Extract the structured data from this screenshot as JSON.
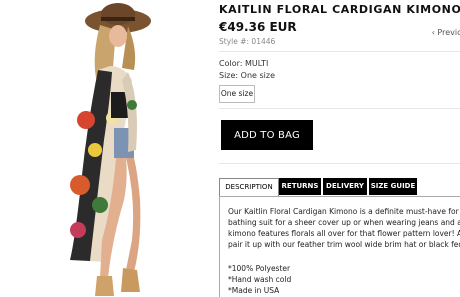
{
  "product": {
    "title": "KAITLIN FLORAL CARDIGAN KIMONO",
    "price": "€49.36 EUR",
    "style_number": "Style #: 01446",
    "color_label": "Color: MULTI",
    "size_label": "Size: One size",
    "size_option": "One size",
    "add_to_bag": "ADD TO BAG",
    "prev_link": "‹ Previo"
  },
  "tabs": [
    "DESCRIPTION",
    "RETURNS",
    "DELIVERY",
    "SIZE GUIDE"
  ],
  "description": {
    "line1": "Our Kaitlin Floral Cardigan Kimono is a definite must-have for the s",
    "line2": "bathing suit for a sheer cover up or when wearing jeans and a cro",
    "line3": "kimono features florals all over for that flower pattern lover! Add a",
    "line4": "pair it up with our feather trim wool wide brim hat or black fedora",
    "bullet1": "*100% Polyester",
    "bullet2": "*Hand wash cold",
    "bullet3": "*Made in USA"
  },
  "colors": {
    "button": "#000000",
    "tab_dark": "#000000"
  }
}
